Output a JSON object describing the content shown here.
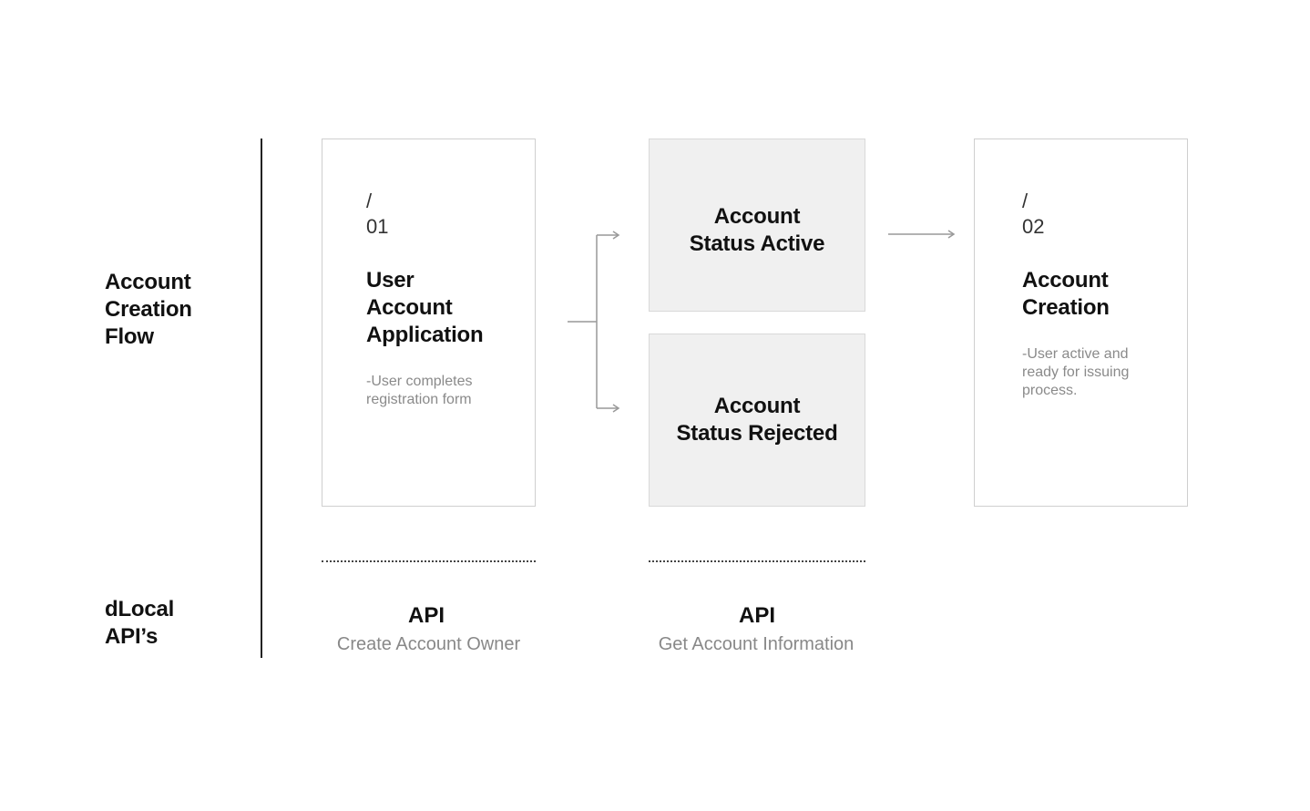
{
  "rows": {
    "flow_label": "Account\nCreation\nFlow",
    "api_label": "dLocal\nAPI’s"
  },
  "steps": [
    {
      "slash": "/",
      "number": "01",
      "title": "User\nAccount\nApplication",
      "description": "-User completes\nregistration form"
    },
    {
      "slash": "/",
      "number": "02",
      "title": "Account\nCreation",
      "description": "-User active and\nready for issuing\nprocess."
    }
  ],
  "statuses": {
    "active": "Account\nStatus Active",
    "rejected": "Account\nStatus Rejected"
  },
  "apis": [
    {
      "title": "API",
      "name": "Create Account Owner"
    },
    {
      "title": "API",
      "name": "Get Account Information"
    }
  ],
  "colors": {
    "card_border": "#cfcfcf",
    "status_fill": "#f0f0f0",
    "connector": "#999999",
    "muted_text": "#8a8a8a"
  }
}
